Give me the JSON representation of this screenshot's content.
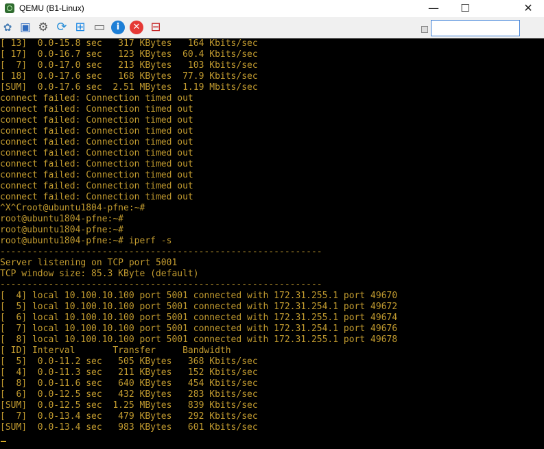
{
  "window": {
    "title": "QEMU (B1-Linux)",
    "minimize_glyph": "—",
    "maximize_glyph": "☐",
    "close_glyph": "✕"
  },
  "toolbar": {
    "buttons": [
      {
        "name": "network-icon",
        "glyph": "✿",
        "color": "#4a7fb5"
      },
      {
        "name": "fullscreen-icon",
        "glyph": "▣",
        "color": "#2f6bbf"
      },
      {
        "name": "settings-icon",
        "glyph": "⚙",
        "color": "#555555"
      },
      {
        "name": "refresh-icon",
        "glyph": "⟳",
        "color": "#2a8fd8"
      },
      {
        "name": "windows-icon",
        "glyph": "⊞",
        "color": "#1e88e5"
      },
      {
        "name": "terminal-icon",
        "glyph": "▭",
        "color": "#555555"
      },
      {
        "name": "info-icon",
        "glyph": "i",
        "color": "#1e7fd6"
      },
      {
        "name": "stop-icon",
        "glyph": "✕",
        "color": "#e53935"
      },
      {
        "name": "eject-icon",
        "glyph": "⊟",
        "color": "#c62828"
      }
    ],
    "search_value": ""
  },
  "terminal": {
    "text_color": "#c29b2f",
    "background": "#000000",
    "lines": [
      "[ 13]  0.0-15.8 sec   317 KBytes   164 Kbits/sec",
      "[ 17]  0.0-16.7 sec   123 KBytes  60.4 Kbits/sec",
      "[  7]  0.0-17.0 sec   213 KBytes   103 Kbits/sec",
      "[ 18]  0.0-17.6 sec   168 KBytes  77.9 Kbits/sec",
      "[SUM]  0.0-17.6 sec  2.51 MBytes  1.19 Mbits/sec",
      "connect failed: Connection timed out",
      "connect failed: Connection timed out",
      "connect failed: Connection timed out",
      "connect failed: Connection timed out",
      "connect failed: Connection timed out",
      "connect failed: Connection timed out",
      "connect failed: Connection timed out",
      "connect failed: Connection timed out",
      "connect failed: Connection timed out",
      "connect failed: Connection timed out",
      "^X^Croot@ubuntu1804-pfne:~#",
      "root@ubuntu1804-pfne:~#",
      "root@ubuntu1804-pfne:~#",
      "root@ubuntu1804-pfne:~# iperf -s",
      "------------------------------------------------------------",
      "Server listening on TCP port 5001",
      "TCP window size: 85.3 KByte (default)",
      "------------------------------------------------------------",
      "[  4] local 10.100.10.100 port 5001 connected with 172.31.255.1 port 49670",
      "[  5] local 10.100.10.100 port 5001 connected with 172.31.254.1 port 49672",
      "[  6] local 10.100.10.100 port 5001 connected with 172.31.255.1 port 49674",
      "[  7] local 10.100.10.100 port 5001 connected with 172.31.254.1 port 49676",
      "[  8] local 10.100.10.100 port 5001 connected with 172.31.255.1 port 49678",
      "[ ID] Interval       Transfer     Bandwidth",
      "[  5]  0.0-11.2 sec   505 KBytes   368 Kbits/sec",
      "[  4]  0.0-11.3 sec   211 KBytes   152 Kbits/sec",
      "[  8]  0.0-11.6 sec   640 KBytes   454 Kbits/sec",
      "[  6]  0.0-12.5 sec   432 KBytes   283 Kbits/sec",
      "[SUM]  0.0-12.5 sec  1.25 MBytes   839 Kbits/sec",
      "[  7]  0.0-13.4 sec   479 KBytes   292 Kbits/sec",
      "[SUM]  0.0-13.4 sec   983 KBytes   601 Kbits/sec"
    ]
  }
}
